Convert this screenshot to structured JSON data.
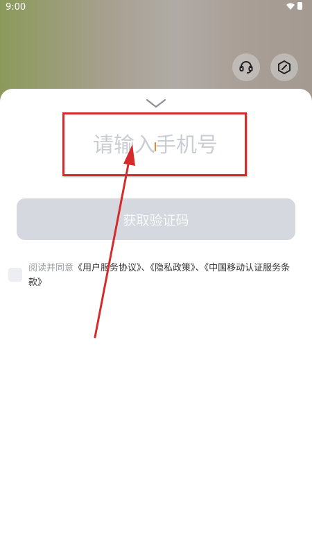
{
  "status_bar": {
    "time": "9:00"
  },
  "top_icons": {
    "headset": "headset-icon",
    "tools": "tools-icon"
  },
  "login": {
    "phone_placeholder": "请输入手机号",
    "get_code_label": "获取验证码",
    "agreement": {
      "prefix": "阅读并同意",
      "user_agreement": "《用户服务协议》",
      "sep1": "、",
      "privacy": "《隐私政策》",
      "sep2": "、",
      "cmcc_terms": "《中国移动认证服务条款》"
    }
  },
  "colors": {
    "highlight": "#d52b2b",
    "button_disabled": "#d5d8de",
    "caret": "#e58b2a"
  }
}
